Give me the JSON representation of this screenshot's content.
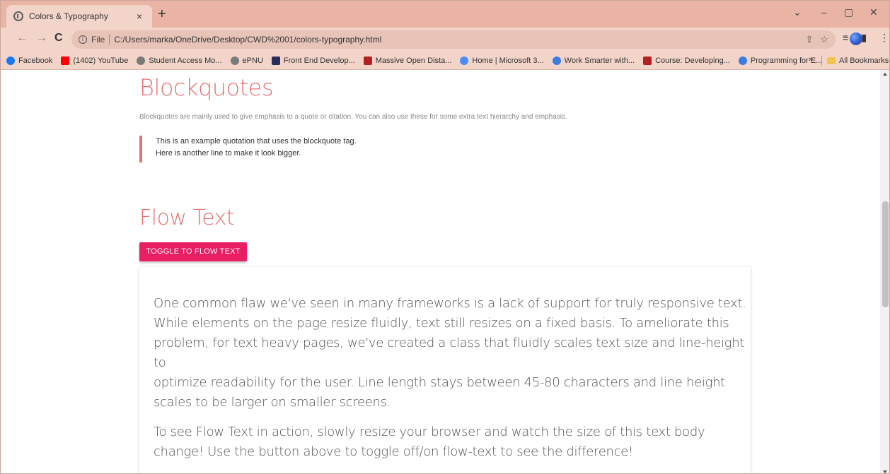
{
  "browser": {
    "tab_title": "Colors & Typography",
    "tab_close": "×",
    "new_tab": "+",
    "url_scheme_label": "File",
    "url": "C:/Users/marka/OneDrive/Desktop/CWD%2001/colors-typography.html",
    "window_controls": {
      "minimize": "–",
      "restore": "▢",
      "close": "✕",
      "dropdown": "⌄"
    },
    "nav": {
      "back": "←",
      "forward": "→",
      "reload": "C"
    },
    "bookmarks": [
      {
        "label": "Facebook",
        "color": "#1877f2"
      },
      {
        "label": "(1402) YouTube",
        "color": "#ff0000"
      },
      {
        "label": "Student Access Mo...",
        "color": "#7a7a7a"
      },
      {
        "label": "ePNU",
        "color": "#7a7a7a"
      },
      {
        "label": "Front End Develop...",
        "color": "#2b2b5b"
      },
      {
        "label": "Massive Open Dista...",
        "color": "#b22222"
      },
      {
        "label": "Home | Microsoft 3...",
        "color": "#4b8df8"
      },
      {
        "label": "Work Smarter with...",
        "color": "#3c7be0"
      },
      {
        "label": "Course: Developing...",
        "color": "#b22222"
      },
      {
        "label": "Programming for E...",
        "color": "#3c7be0"
      }
    ],
    "bookmarks_more": "»",
    "all_bookmarks": "All Bookmarks"
  },
  "page": {
    "blockquotes_heading": "Blockquotes",
    "blockquotes_description": "Blockquotes are mainly used to give emphasis to a quote or citation. You can also use these for some extra text hierarchy and emphasis.",
    "blockquote_lines": [
      "This is an example quotation that uses the blockquote tag.",
      "Here is another line to make it look bigger."
    ],
    "flow_heading": "Flow Text",
    "toggle_button": "TOGGLE TO FLOW TEXT",
    "flow_paragraphs": [
      [
        "One common flaw we've seen in many frameworks is a lack of support for truly responsive text.",
        "While elements on the page resize fluidly, text still resizes on a fixed basis. To ameliorate this",
        "problem, for text heavy pages, we've created a class that fluidly scales text size and line-height to",
        "optimize readability for the user. Line length stays between 45-80 characters and line height",
        "scales to be larger on smaller screens."
      ],
      [
        "To see Flow Text in action, slowly resize your browser and watch the size of this text body",
        "change! Use the button above to toggle off/on flow-text to see the difference!"
      ]
    ]
  },
  "colors": {
    "accent_red": "#e57373",
    "button_pink": "#e91e63",
    "chrome_tabstrip": "#e9b4a4",
    "chrome_toolbar": "#f2d4c9"
  }
}
